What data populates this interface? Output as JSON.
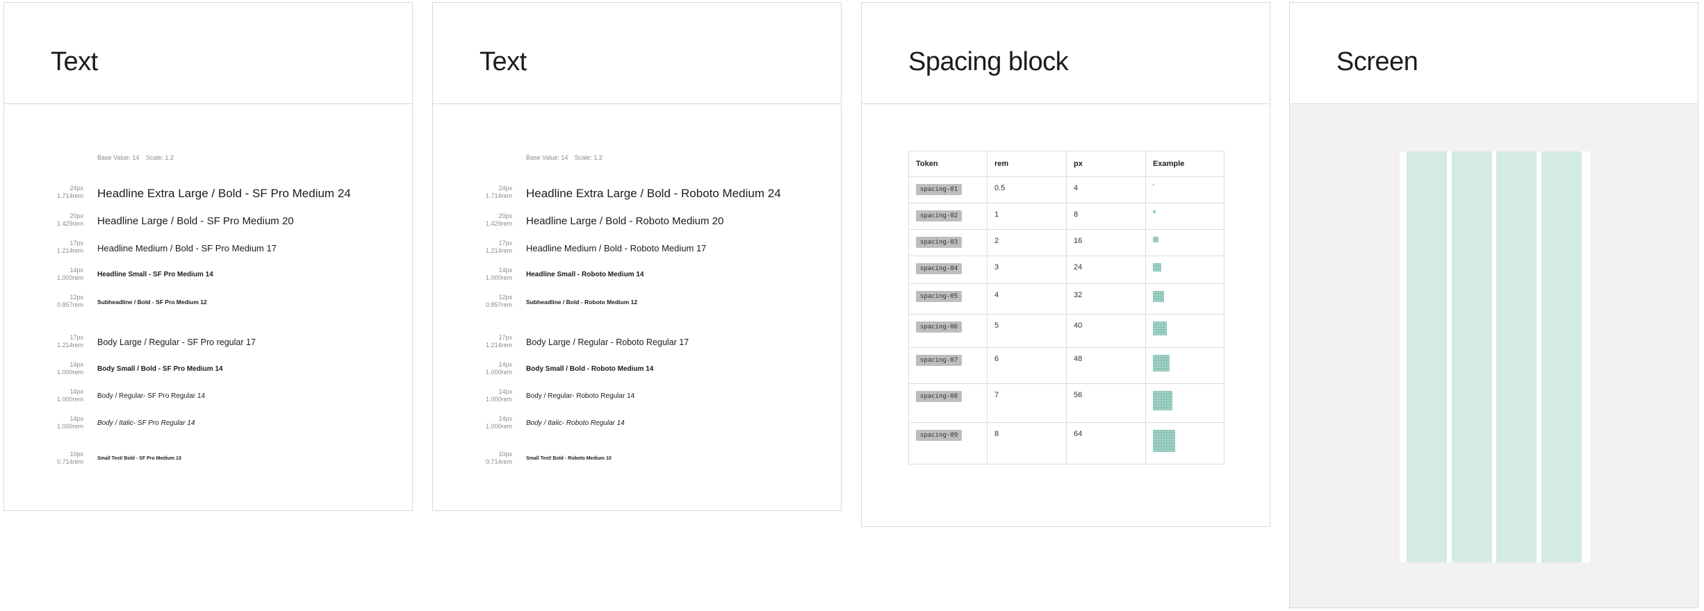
{
  "panels": {
    "text_sf": {
      "title": "Text",
      "meta": {
        "base": "Base Value: 14",
        "scale": "Scale: 1.2"
      },
      "rows": [
        {
          "px": "24px",
          "rem": "1.714rem",
          "label": "Headline Extra Large / Bold - SF Pro Medium 24"
        },
        {
          "px": "20px",
          "rem": "1.429rem",
          "label": "Headline Large / Bold - SF Pro Medium 20"
        },
        {
          "px": "17px",
          "rem": "1.214rem",
          "label": "Headline Medium / Bold - SF Pro Medium 17"
        },
        {
          "px": "14px",
          "rem": "1.000rem",
          "label": "Headline Small - SF Pro Medium 14"
        },
        {
          "px": "12px",
          "rem": "0.857rem",
          "label": "Subheadline / Bold - SF Pro Medium 12"
        },
        {
          "px": "17px",
          "rem": "1.214rem",
          "label": "Body Large / Regular - SF Pro regular 17"
        },
        {
          "px": "14px",
          "rem": "1.000rem",
          "label": "Body Small / Bold - SF Pro Medium 14"
        },
        {
          "px": "14px",
          "rem": "1.000rem",
          "label": "Body / Regular- SF Pro Regular 14"
        },
        {
          "px": "14px",
          "rem": "1.000rem",
          "label": "Body / Italic- SF Pro Regular 14"
        },
        {
          "px": "10px",
          "rem": "0.714rem",
          "label": "Small Text/ Bold - SF Pro Medium 10"
        }
      ]
    },
    "text_roboto": {
      "title": "Text",
      "meta": {
        "base": "Base Value: 14",
        "scale": "Scale: 1.2"
      },
      "rows": [
        {
          "px": "24px",
          "rem": "1.714rem",
          "label": "Headline Extra Large / Bold - Roboto Medium 24"
        },
        {
          "px": "20px",
          "rem": "1.429rem",
          "label": "Headline Large / Bold - Roboto Medium 20"
        },
        {
          "px": "17px",
          "rem": "1.214rem",
          "label": "Headline Medium / Bold - Roboto Medium 17"
        },
        {
          "px": "14px",
          "rem": "1.000rem",
          "label": "Headline Small - Roboto Medium 14"
        },
        {
          "px": "12px",
          "rem": "0.857rem",
          "label": "Subheadline / Bold - Roboto Medium 12"
        },
        {
          "px": "17px",
          "rem": "1.214rem",
          "label": "Body Large / Regular - Roboto Regular 17"
        },
        {
          "px": "14px",
          "rem": "1.000rem",
          "label": "Body Small / Bold - Roboto Medium 14"
        },
        {
          "px": "14px",
          "rem": "1.000rem",
          "label": "Body / Regular- Roboto Regular 14"
        },
        {
          "px": "14px",
          "rem": "1.000rem",
          "label": "Body / Italic- Roboto Regular 14"
        },
        {
          "px": "10px",
          "rem": "0.714rem",
          "label": "Small Text/ Bold - Roboto Medium 10"
        }
      ]
    },
    "spacing": {
      "title": "Spacing block",
      "headers": {
        "token": "Token",
        "rem": "rem",
        "px": "px",
        "example": "Example"
      },
      "rows": [
        {
          "token": "spacing-01",
          "rem": "0.5",
          "px": "4"
        },
        {
          "token": "spacing-02",
          "rem": "1",
          "px": "8"
        },
        {
          "token": "spacing-03",
          "rem": "2",
          "px": "16"
        },
        {
          "token": "spacing-04",
          "rem": "3",
          "px": "24"
        },
        {
          "token": "spacing-05",
          "rem": "4",
          "px": "32"
        },
        {
          "token": "spacing-06",
          "rem": "5",
          "px": "40"
        },
        {
          "token": "spacing-07",
          "rem": "6",
          "px": "48"
        },
        {
          "token": "spacing-08",
          "rem": "7",
          "px": "56"
        },
        {
          "token": "spacing-09",
          "rem": "8",
          "px": "64"
        }
      ],
      "swatch_color": "#8fc6ba"
    },
    "screen": {
      "title": "Screen",
      "columns": 4,
      "column_color": "#d4eae5",
      "background_color": "#f2f2f2"
    }
  }
}
